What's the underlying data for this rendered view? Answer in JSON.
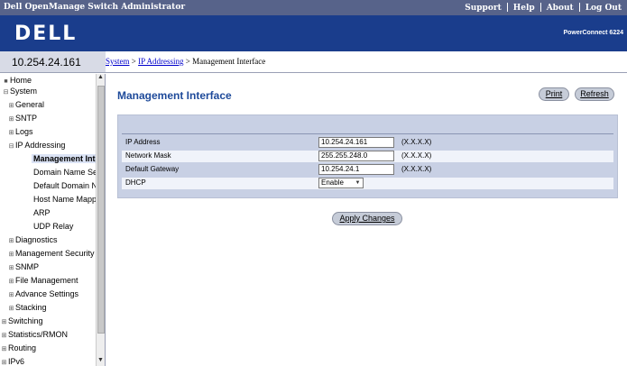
{
  "header": {
    "app_title": "Dell OpenManage Switch Administrator",
    "links": [
      "Support",
      "Help",
      "About",
      "Log Out"
    ],
    "logo": "DELL",
    "product": "PowerConnect 6224"
  },
  "device_ip": "10.254.24.161",
  "breadcrumb": {
    "items": [
      "System",
      "IP Addressing"
    ],
    "separator": " > ",
    "current": "Management Interface"
  },
  "tree": {
    "items": [
      {
        "label": "Home",
        "icon": "home-icon"
      },
      {
        "label": "System",
        "icon": "minus-icon"
      },
      {
        "label": "General",
        "icon": "plus-icon"
      },
      {
        "label": "SNTP",
        "icon": "plus-icon"
      },
      {
        "label": "Logs",
        "icon": "plus-icon"
      },
      {
        "label": "IP Addressing",
        "icon": "minus-icon"
      },
      {
        "label": "Management Interface",
        "icon": ""
      },
      {
        "label": "Domain Name Server",
        "icon": ""
      },
      {
        "label": "Default Domain Name",
        "icon": ""
      },
      {
        "label": "Host Name Mapping",
        "icon": ""
      },
      {
        "label": "ARP",
        "icon": ""
      },
      {
        "label": "UDP Relay",
        "icon": ""
      },
      {
        "label": "Diagnostics",
        "icon": "plus-icon"
      },
      {
        "label": "Management Security",
        "icon": "plus-icon"
      },
      {
        "label": "SNMP",
        "icon": "plus-icon"
      },
      {
        "label": "File Management",
        "icon": "plus-icon"
      },
      {
        "label": "Advance Settings",
        "icon": "plus-icon"
      },
      {
        "label": "Stacking",
        "icon": "plus-icon"
      },
      {
        "label": "Switching",
        "icon": "plus-icon"
      },
      {
        "label": "Statistics/RMON",
        "icon": "plus-icon"
      },
      {
        "label": "Routing",
        "icon": "plus-icon"
      },
      {
        "label": "IPv6",
        "icon": "plus-icon"
      }
    ]
  },
  "page": {
    "title": "Management Interface",
    "print_label": "Print",
    "refresh_label": "Refresh",
    "apply_label": "Apply Changes"
  },
  "form": {
    "ip_address": {
      "label": "IP Address",
      "value": "10.254.24.161",
      "hint": "(X.X.X.X)"
    },
    "network_mask": {
      "label": "Network Mask",
      "value": "255.255.248.0",
      "hint": "(X.X.X.X)"
    },
    "default_gateway": {
      "label": "Default Gateway",
      "value": "10.254.24.1",
      "hint": "(X.X.X.X)"
    },
    "dhcp": {
      "label": "DHCP",
      "value": "Enable"
    }
  },
  "colors": {
    "top_bar": "#57638a",
    "brand_bar": "#1a3d8c",
    "title": "#1e4a9a",
    "panel": "#c8d0e4"
  }
}
